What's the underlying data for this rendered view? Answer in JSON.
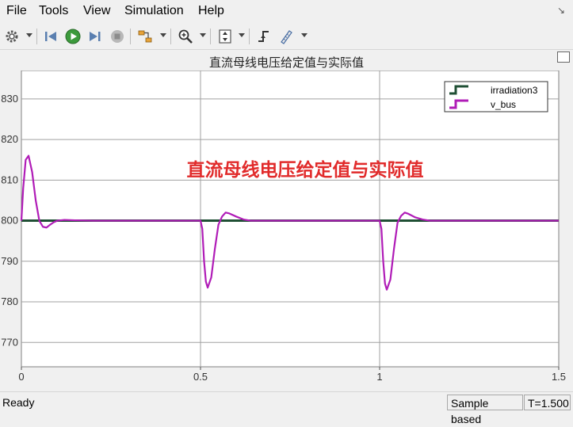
{
  "menu": {
    "items": [
      {
        "label": "File"
      },
      {
        "label": "Tools"
      },
      {
        "label": "View"
      },
      {
        "label": "Simulation"
      },
      {
        "label": "Help"
      }
    ]
  },
  "toolbar": {
    "icons": [
      "gear-icon",
      "rewind-icon",
      "run-icon",
      "step-forward-icon",
      "stop-icon",
      "highlight-block-icon",
      "zoom-in-icon",
      "fit-axes-icon",
      "trigger-icon",
      "cursor-measurement-icon"
    ]
  },
  "plot": {
    "overlay_text": "直流母线电压给定值与实际值",
    "colors": {
      "background": "#ffffff",
      "grid": "#a0a0a0",
      "irradiation3": "#1f4f34",
      "v_bus": "#b01cb7",
      "overlay": "#e12b2b"
    }
  },
  "chart_data": {
    "type": "line",
    "title": "直流母线电压给定值与实际值",
    "xlabel": "",
    "ylabel": "",
    "xlim": [
      0,
      1.5
    ],
    "ylim": [
      764,
      837
    ],
    "x_ticks": [
      "0",
      "0.5",
      "1",
      "1.5"
    ],
    "y_ticks": [
      "770",
      "780",
      "790",
      "800",
      "810",
      "820",
      "830"
    ],
    "grid": true,
    "legend_position": "top-right",
    "series": [
      {
        "name": "irradiation3",
        "x": [
          0,
          1.5
        ],
        "y": [
          800,
          800
        ]
      },
      {
        "name": "v_bus",
        "x": [
          0,
          0.005,
          0.012,
          0.02,
          0.03,
          0.04,
          0.05,
          0.06,
          0.07,
          0.08,
          0.09,
          0.1,
          0.12,
          0.15,
          0.2,
          0.3,
          0.4,
          0.5,
          0.505,
          0.51,
          0.515,
          0.52,
          0.53,
          0.54,
          0.55,
          0.56,
          0.57,
          0.58,
          0.6,
          0.62,
          0.64,
          0.66,
          0.7,
          0.8,
          0.9,
          1.0,
          1.005,
          1.01,
          1.015,
          1.02,
          1.03,
          1.04,
          1.05,
          1.06,
          1.07,
          1.08,
          1.1,
          1.12,
          1.14,
          1.16,
          1.2,
          1.3,
          1.4,
          1.5
        ],
        "y": [
          800,
          808,
          815,
          816,
          812,
          805,
          800,
          798.5,
          798.3,
          799,
          799.6,
          800,
          800.2,
          800.1,
          800,
          800,
          800,
          800,
          798,
          790,
          785,
          783.5,
          786,
          793,
          799,
          801,
          802,
          801.8,
          801,
          800.3,
          800,
          800,
          800,
          800,
          800,
          800,
          798,
          790,
          784.5,
          783,
          785.5,
          793,
          799.5,
          801.2,
          802,
          801.7,
          800.8,
          800.3,
          800,
          800,
          800,
          800,
          800,
          800
        ]
      }
    ]
  },
  "status": {
    "ready": "Ready",
    "sample": "Sample based",
    "time": "T=1.500"
  }
}
